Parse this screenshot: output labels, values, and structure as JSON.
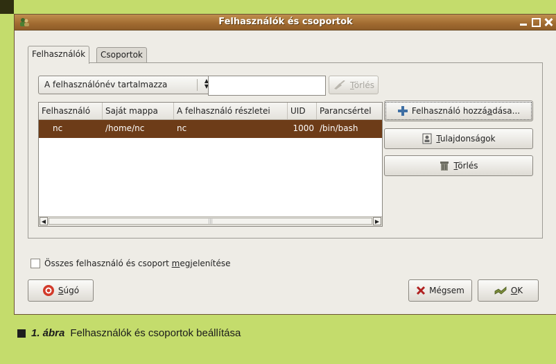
{
  "window": {
    "title": "Felhasználók és csoportok"
  },
  "tabs": [
    {
      "label": "Felhasználók",
      "active": true
    },
    {
      "label": "Csoportok",
      "active": false
    }
  ],
  "filter": {
    "combo_value": "A felhasználónév tartalmazza",
    "search_value": "",
    "clear_button": {
      "label": "Törlés",
      "mnemonic": "T",
      "rest": "örlés",
      "enabled": false
    }
  },
  "table": {
    "columns": [
      "Felhasználó",
      "Saját mappa",
      "A felhasználó részletei",
      "UID",
      "Parancsértel"
    ],
    "rows": [
      {
        "user": "nc",
        "home": "/home/nc",
        "details": "nc",
        "uid": "1000",
        "shell": "/bin/bash",
        "selected": true
      }
    ]
  },
  "side_buttons": {
    "add": {
      "label": "Felhasználó hozzáadása...",
      "before": "Felhasználó hozzá",
      "mnemonic": "a",
      "after": "dása...",
      "icon": "plus-icon"
    },
    "properties": {
      "label": "Tulajdonságok",
      "mnemonic": "T",
      "rest": "ulajdonságok",
      "icon": "properties-icon"
    },
    "delete": {
      "label": "Törlés",
      "mnemonic": "T",
      "rest": "örlés",
      "icon": "trash-icon"
    }
  },
  "show_all": {
    "label": "Összes felhasználó és csoport megjelenítése",
    "before": "Összes felhasználó és csoport ",
    "mnemonic": "m",
    "after": "egjelenítése",
    "checked": false
  },
  "footer": {
    "help": {
      "label": "Súgó",
      "mnemonic": "S",
      "rest": "úgó",
      "icon": "help-icon"
    },
    "cancel": {
      "label": "Mégsem",
      "icon": "cancel-icon"
    },
    "ok": {
      "label": "OK",
      "mnemonic": "O",
      "rest": "K",
      "icon": "ok-icon"
    }
  },
  "caption": {
    "figure_label": "1. ábra",
    "text": "Felhasználók és csoportok beállítása"
  },
  "colors": {
    "background": "#c4dc6c",
    "titlebar": "#a06a30",
    "selection": "#6d3c18",
    "window": "#eeece6"
  }
}
